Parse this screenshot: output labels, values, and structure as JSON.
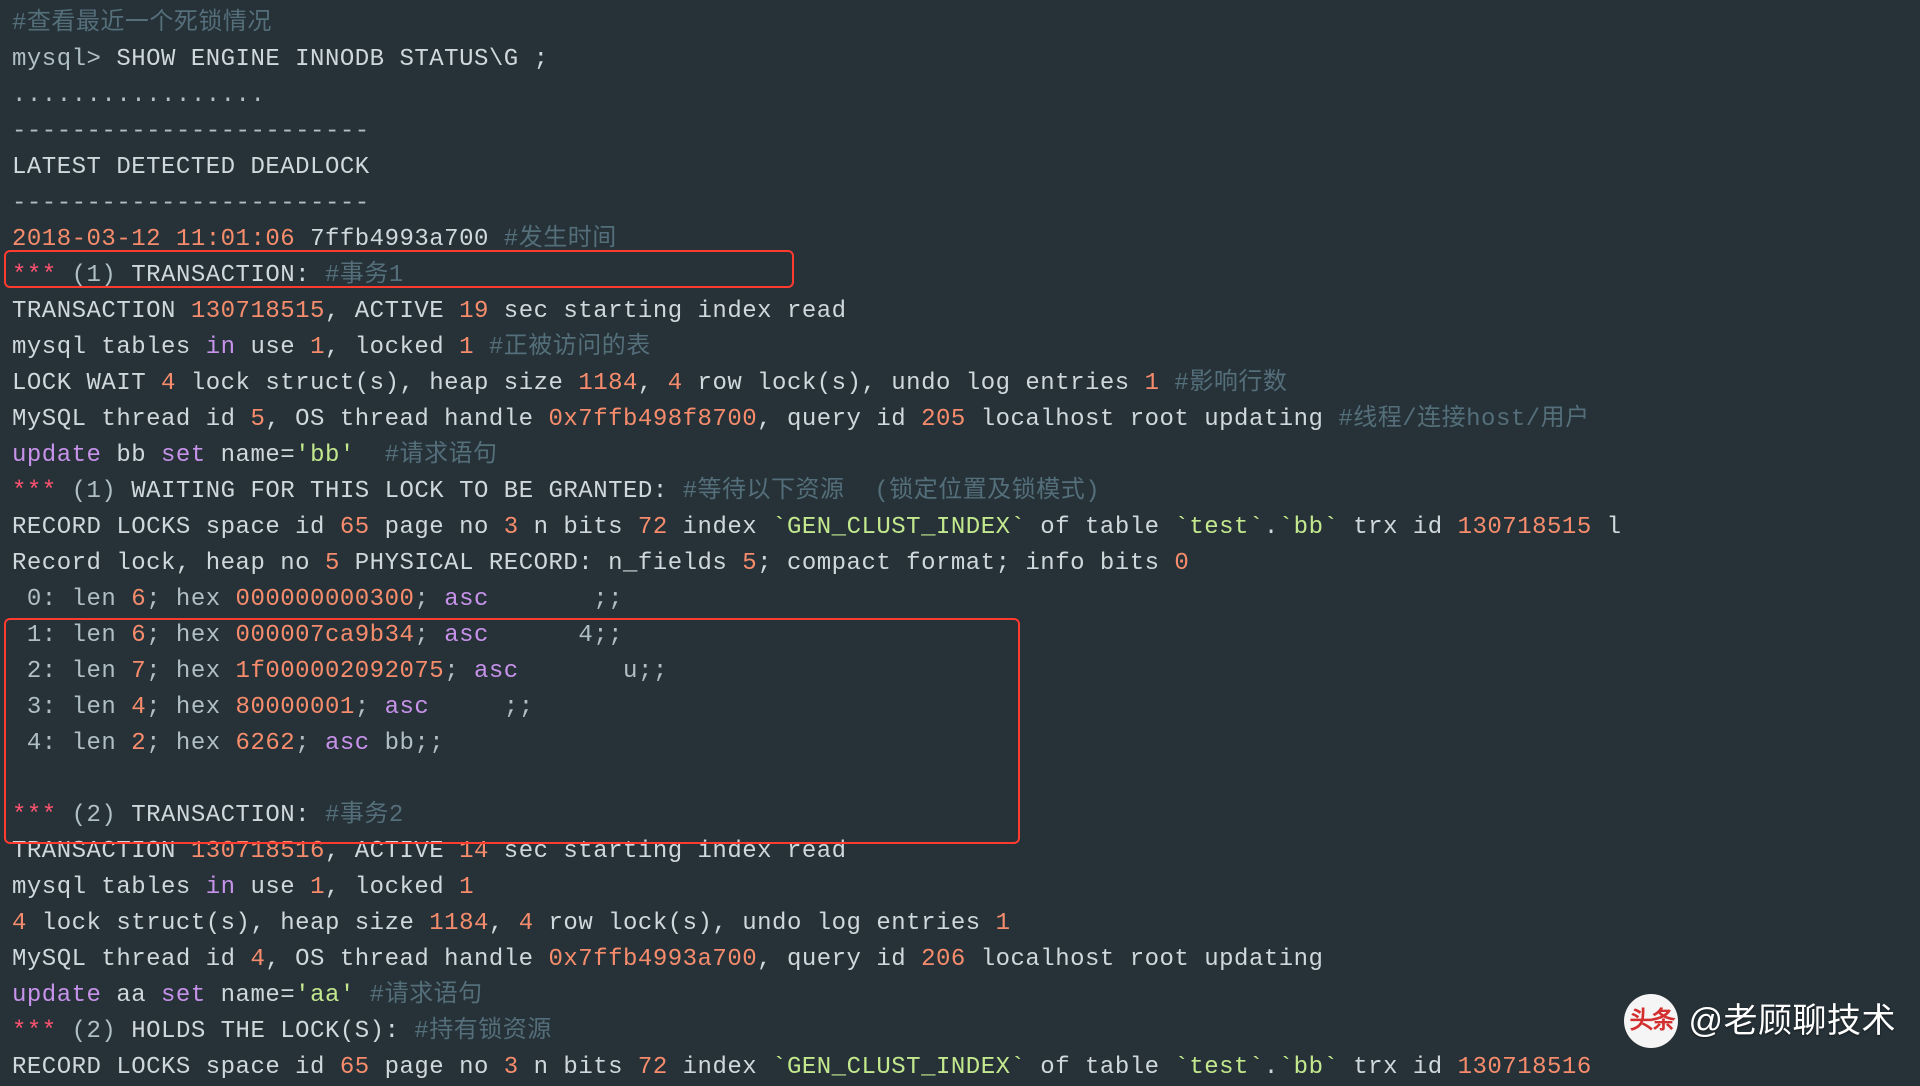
{
  "c1": "#查看最近一个死锁情况",
  "p": "mysql>",
  "cmd": " SHOW ENGINE INNODB STATUS\\G ;",
  "dots": ".................",
  "dash": "------------------------",
  "hdr": "LATEST DETECTED DEADLOCK",
  "ts": {
    "date": "2018-03-12",
    "time": "11:01:06",
    "hex": "7ffb4993a700",
    "note": "#发生时间"
  },
  "t1": {
    "star": "*** ",
    "n": "(1)",
    "lbl": " TRANSACTION: ",
    "note": "#事务1",
    "trx": {
      "a": "TRANSACTION ",
      "id": "130718515",
      "b": ", ACTIVE ",
      "sec": "19",
      "c": " sec starting index read"
    },
    "tbl": {
      "a": "mysql tables ",
      "in": "in",
      "b": " use ",
      "u": "1",
      "c": ", locked ",
      "l": "1",
      "note": " #正被访问的表"
    },
    "lock": {
      "a": "LOCK WAIT ",
      "n1": "4",
      "b": " lock struct(s), heap size ",
      "n2": "1184",
      "c": ", ",
      "n3": "4",
      "d": " row lock(s), undo log entries ",
      "n4": "1",
      "note": " #影响行数"
    },
    "thr": {
      "a": "MySQL thread id ",
      "n1": "5",
      "b": ", OS thread handle ",
      "h": "0x7ffb498f8700",
      "c": ", query id ",
      "n2": "205",
      "d": " localhost root updating",
      "note": " #线程/连接host/用户"
    },
    "upd": {
      "a": "update",
      "b": " bb ",
      "c": "set",
      "d": " name=",
      "e": "'bb'",
      "note": "  #请求语句"
    },
    "wait": {
      "star": "*** ",
      "n": "(1)",
      "lbl": " WAITING FOR THIS LOCK TO BE GRANTED: ",
      "note": "#等待以下资源  (锁定位置及锁模式)"
    },
    "rec": {
      "a": "RECORD LOCKS space id ",
      "n1": "65",
      "b": " page no ",
      "n2": "3",
      "c": " n bits ",
      "n3": "72",
      "d": " index ",
      "idx": "`GEN_CLUST_INDEX`",
      "e": " of table ",
      "tbl": "`test`",
      "dot": ".",
      "tbl2": "`bb`",
      "f": " trx id ",
      "tid": "130718515",
      "g": " l"
    },
    "rl": {
      "a": "Record lock, heap no ",
      "n1": "5",
      "b": " PHYSICAL RECORD: n_fields ",
      "n2": "5",
      "c": "; compact format; info bits ",
      "n3": "0"
    },
    "f0": {
      "a": " 0: len ",
      "n": "6",
      "b": "; hex ",
      "h": "000000000300",
      "c": "; ",
      "asc": "asc",
      "d": "       ;;"
    },
    "f1": {
      "a": " 1: len ",
      "n": "6",
      "b": "; hex ",
      "h": "000007ca9b34",
      "c": "; ",
      "asc": "asc",
      "d": "      4;;"
    },
    "f2": {
      "a": " 2: len ",
      "n": "7",
      "b": "; hex ",
      "h": "1f000002092075",
      "c": "; ",
      "asc": "asc",
      "d": "       u;;"
    },
    "f3": {
      "a": " 3: len ",
      "n": "4",
      "b": "; hex ",
      "h": "80000001",
      "c": "; ",
      "asc": "asc",
      "d": "     ;;"
    },
    "f4": {
      "a": " 4: len ",
      "n": "2",
      "b": "; hex ",
      "h": "6262",
      "c": "; ",
      "asc": "asc",
      "d": " bb;;"
    }
  },
  "t2": {
    "star": "*** ",
    "n": "(2)",
    "lbl": " TRANSACTION: ",
    "note": "#事务2",
    "trx": {
      "a": "TRANSACTION ",
      "id": "130718516",
      "b": ", ACTIVE ",
      "sec": "14",
      "c": " sec starting index read"
    },
    "tbl": {
      "a": "mysql tables ",
      "in": "in",
      "b": " use ",
      "u": "1",
      "c": ", locked ",
      "l": "1"
    },
    "lock": {
      "n1": "4",
      "b": " lock struct(s), heap size ",
      "n2": "1184",
      "c": ", ",
      "n3": "4",
      "d": " row lock(s), undo log entries ",
      "n4": "1"
    },
    "thr": {
      "a": "MySQL thread id ",
      "n1": "4",
      "b": ", OS thread handle ",
      "h": "0x7ffb4993a700",
      "c": ", query id ",
      "n2": "206",
      "d": " localhost root updating"
    },
    "upd": {
      "a": "update",
      "b": " aa ",
      "c": "set",
      "d": " name=",
      "e": "'aa'",
      "note": " #请求语句"
    },
    "hold": {
      "star": "*** ",
      "n": "(2)",
      "lbl": " HOLDS THE LOCK(S): ",
      "note": "#持有锁资源"
    },
    "rec": {
      "a": "RECORD LOCKS space id ",
      "n1": "65",
      "b": " page no ",
      "n2": "3",
      "c": " n bits ",
      "n3": "72",
      "d": " index ",
      "idx": "`GEN_CLUST_INDEX`",
      "e": " of table ",
      "tbl": "`test`",
      "dot": ".",
      "tbl2": "`bb`",
      "f": " trx id ",
      "tid": "130718516"
    }
  },
  "wm": {
    "logo": "头条",
    "txt": "@老顾聊技术"
  }
}
